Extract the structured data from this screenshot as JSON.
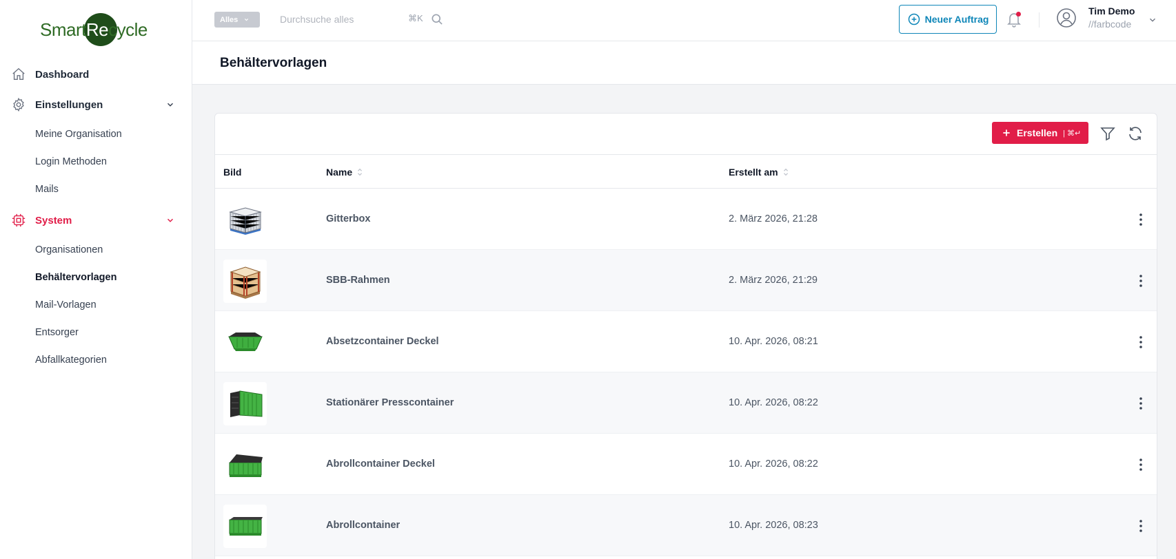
{
  "brand": {
    "logo_part1": "Smart",
    "logo_part2": "Re",
    "logo_part3": "cycle"
  },
  "sidebar": {
    "dashboard": "Dashboard",
    "settings": "Einstellungen",
    "settings_items": [
      "Meine Organisation",
      "Login Methoden",
      "Mails"
    ],
    "system": "System",
    "system_items": [
      "Organisationen",
      "Behältervorlagen",
      "Mail-Vorlagen",
      "Entsorger",
      "Abfallkategorien"
    ],
    "active_item": "Behältervorlagen",
    "accent_color": "#e11d48"
  },
  "topbar": {
    "scope": "Alles",
    "search_placeholder": "Durchsuche alles",
    "shortcut": "⌘K",
    "new_order_label": "Neuer Auftrag",
    "user_name": "Tim Demo",
    "user_org": "//farbcode"
  },
  "page": {
    "title": "Behältervorlagen"
  },
  "toolbar": {
    "create_label": "Erstellen",
    "create_shortcut": "| ⌘↵"
  },
  "table": {
    "columns": {
      "image": "Bild",
      "name": "Name",
      "created": "Erstellt am"
    },
    "rows": [
      {
        "name": "Gitterbox",
        "created": "2. März 2026, 21:28",
        "image": "wire-mesh-box"
      },
      {
        "name": "SBB-Rahmen",
        "created": "2. März 2026, 21:29",
        "image": "wooden-pallet-frame"
      },
      {
        "name": "Absetzcontainer Deckel",
        "created": "10. Apr. 2026, 08:21",
        "image": "skip-container-lid"
      },
      {
        "name": "Stationärer Presscontainer",
        "created": "10. Apr. 2026, 08:22",
        "image": "press-container"
      },
      {
        "name": "Abrollcontainer Deckel",
        "created": "10. Apr. 2026, 08:22",
        "image": "roll-off-container-lid"
      },
      {
        "name": "Abrollcontainer",
        "created": "10. Apr. 2026, 08:23",
        "image": "roll-off-container"
      }
    ]
  }
}
